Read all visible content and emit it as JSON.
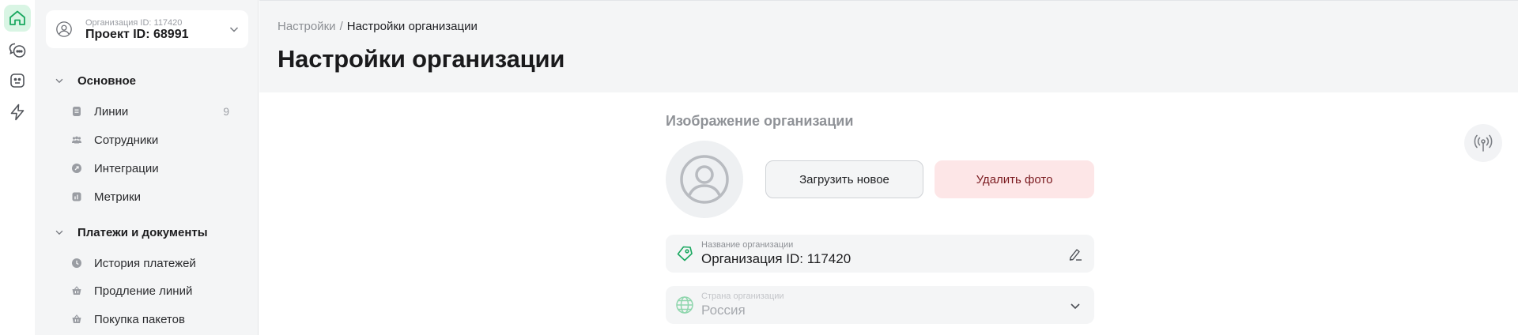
{
  "rail": {
    "items": [
      {
        "name": "home-icon",
        "active": true
      },
      {
        "name": "chats-icon",
        "active": false
      },
      {
        "name": "bot-icon",
        "active": false
      },
      {
        "name": "lightning-icon",
        "active": false
      }
    ]
  },
  "sidebar": {
    "org_selector": {
      "subtitle": "Организация ID: 117420",
      "title": "Проект ID: 68991"
    },
    "sections": [
      {
        "title": "Основное",
        "items": [
          {
            "label": "Линии",
            "count": "9",
            "icon": "lines-icon"
          },
          {
            "label": "Сотрудники",
            "count": "",
            "icon": "employees-icon"
          },
          {
            "label": "Интеграции",
            "count": "",
            "icon": "integrations-icon"
          },
          {
            "label": "Метрики",
            "count": "",
            "icon": "metrics-icon"
          }
        ]
      },
      {
        "title": "Платежи и документы",
        "items": [
          {
            "label": "История платежей",
            "icon": "payment-history-icon"
          },
          {
            "label": "Продление линий",
            "icon": "basket-icon"
          },
          {
            "label": "Покупка пакетов",
            "icon": "basket-icon"
          }
        ]
      }
    ]
  },
  "header": {
    "breadcrumb": {
      "parent": "Настройки",
      "separator": "/",
      "current": "Настройки организации"
    },
    "title": "Настройки организации"
  },
  "content": {
    "image_section_label": "Изображение организации",
    "upload_button": "Загрузить новое",
    "delete_button": "Удалить фото",
    "name_field": {
      "label": "Название организации",
      "value": "Организация ID: 117420"
    },
    "country_field": {
      "label": "Страна организации",
      "value": "Россия"
    }
  },
  "colors": {
    "accent": "#1aa860",
    "accent_bg": "#d9f5e4",
    "danger_bg": "#fde6e7",
    "danger_text": "#7a1a1f",
    "sidebar_bg": "#f4f5f6"
  }
}
